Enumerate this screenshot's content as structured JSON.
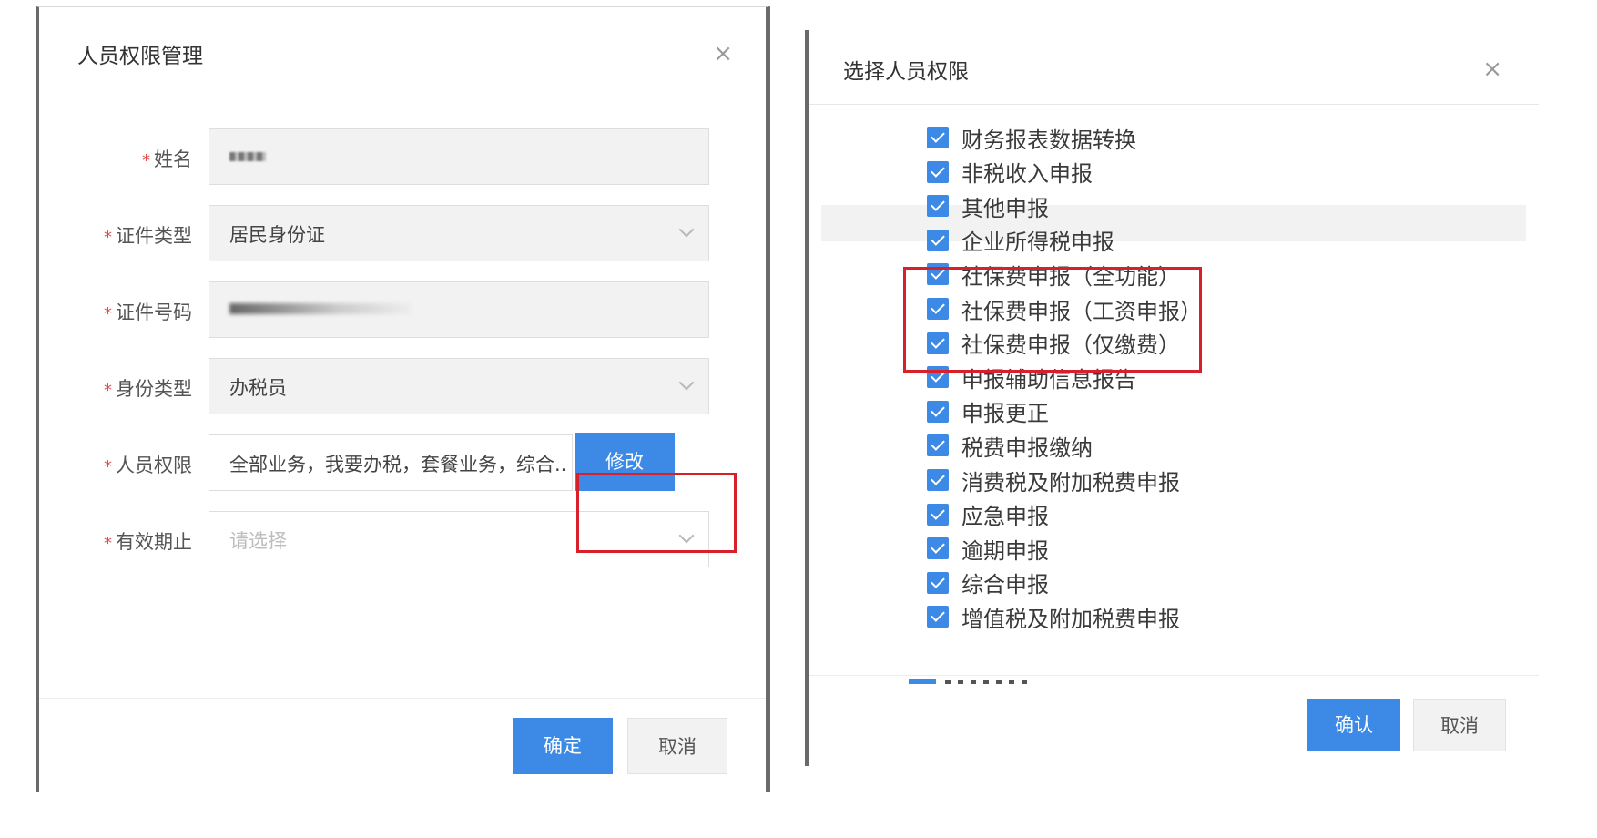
{
  "left_dialog": {
    "title": "人员权限管理",
    "close": "×",
    "fields": {
      "name": {
        "label": "姓名",
        "required": "*"
      },
      "id_type": {
        "label": "证件类型",
        "required": "*",
        "value": "居民身份证"
      },
      "id_number": {
        "label": "证件号码",
        "required": "*"
      },
      "identity_type": {
        "label": "身份类型",
        "required": "*",
        "value": "办税员"
      },
      "permissions": {
        "label": "人员权限",
        "required": "*",
        "value": "全部业务，我要办税，套餐业务，综合..",
        "button": "修改"
      },
      "valid_until": {
        "label": "有效期止",
        "required": "*",
        "placeholder": "请选择"
      }
    },
    "buttons": {
      "confirm": "确定",
      "cancel": "取消"
    }
  },
  "right_dialog": {
    "title": "选择人员权限",
    "close": "×",
    "items": [
      {
        "label": "财务报表数据转换",
        "checked": true
      },
      {
        "label": "非税收入申报",
        "checked": true
      },
      {
        "label": "其他申报",
        "checked": true
      },
      {
        "label": "企业所得税申报",
        "checked": true
      },
      {
        "label": "社保费申报（全功能）",
        "checked": true
      },
      {
        "label": "社保费申报（工资申报）",
        "checked": true
      },
      {
        "label": "社保费申报（仅缴费）",
        "checked": true
      },
      {
        "label": "申报辅助信息报告",
        "checked": true
      },
      {
        "label": "申报更正",
        "checked": true
      },
      {
        "label": "税费申报缴纳",
        "checked": true
      },
      {
        "label": "消费税及附加税费申报",
        "checked": true
      },
      {
        "label": "应急申报",
        "checked": true
      },
      {
        "label": "逾期申报",
        "checked": true
      },
      {
        "label": "综合申报",
        "checked": true
      },
      {
        "label": "增值税及附加税费申报",
        "checked": true
      }
    ],
    "buttons": {
      "confirm": "确认",
      "cancel": "取消"
    }
  },
  "colors": {
    "primary": "#3d8ae6",
    "highlight_box": "#d8202a",
    "required_star": "#e14b4b"
  }
}
